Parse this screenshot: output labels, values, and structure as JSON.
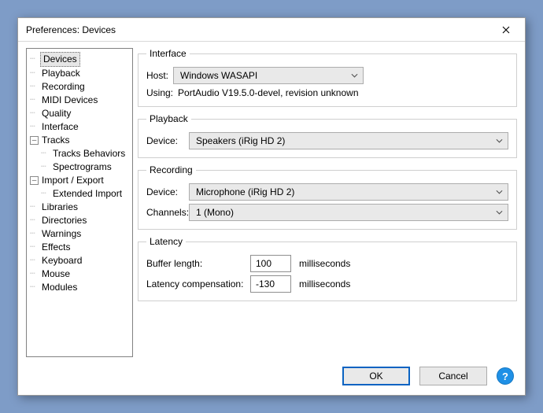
{
  "window": {
    "title": "Preferences: Devices"
  },
  "tree": {
    "items": {
      "devices": "Devices",
      "playback": "Playback",
      "recording": "Recording",
      "midi": "MIDI Devices",
      "quality": "Quality",
      "interface": "Interface",
      "tracks": "Tracks",
      "tracks_behaviors": "Tracks Behaviors",
      "spectrograms": "Spectrograms",
      "import_export": "Import / Export",
      "extended_import": "Extended Import",
      "libraries": "Libraries",
      "directories": "Directories",
      "warnings": "Warnings",
      "effects": "Effects",
      "keyboard": "Keyboard",
      "mouse": "Mouse",
      "modules": "Modules"
    }
  },
  "groups": {
    "interface": {
      "legend": "Interface",
      "host_label": "Host:",
      "host_value": "Windows WASAPI",
      "using_label": "Using:",
      "using_value": "PortAudio V19.5.0-devel, revision unknown"
    },
    "playback": {
      "legend": "Playback",
      "device_label": "Device:",
      "device_value": "Speakers (iRig HD 2)"
    },
    "recording": {
      "legend": "Recording",
      "device_label": "Device:",
      "device_value": "Microphone (iRig HD 2)",
      "channels_label": "Channels:",
      "channels_value": "1 (Mono)"
    },
    "latency": {
      "legend": "Latency",
      "buffer_label": "Buffer length:",
      "buffer_value": "100",
      "buffer_unit": "milliseconds",
      "comp_label": "Latency compensation:",
      "comp_value": "-130",
      "comp_unit": "milliseconds"
    }
  },
  "footer": {
    "ok": "OK",
    "cancel": "Cancel",
    "help": "?"
  }
}
